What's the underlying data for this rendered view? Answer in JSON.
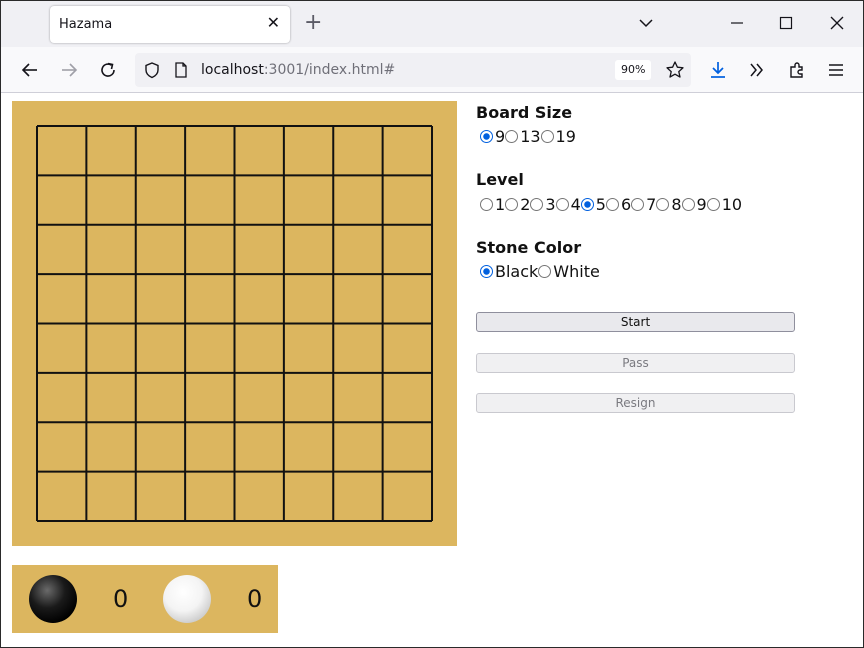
{
  "browser": {
    "tab_title": "Hazama",
    "url_host": "localhost",
    "url_rest": ":3001/index.html#",
    "zoom": "90%"
  },
  "settings": {
    "board_size": {
      "title": "Board Size",
      "options": [
        "9",
        "13",
        "19"
      ],
      "selected": "9"
    },
    "level": {
      "title": "Level",
      "options": [
        "1",
        "2",
        "3",
        "4",
        "5",
        "6",
        "7",
        "8",
        "9",
        "10"
      ],
      "selected": "5"
    },
    "stone_color": {
      "title": "Stone Color",
      "options": [
        "Black",
        "White"
      ],
      "selected": "Black"
    },
    "buttons": {
      "start": "Start",
      "pass": "Pass",
      "resign": "Resign"
    }
  },
  "board": {
    "lines": 9,
    "color": "#dcb65f"
  },
  "score": {
    "black": "0",
    "white": "0"
  }
}
